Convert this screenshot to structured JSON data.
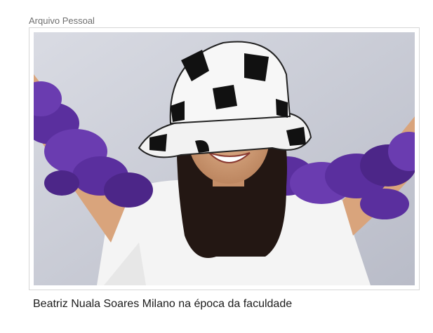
{
  "article_figure": {
    "credit": "Arquivo Pessoal",
    "caption": "Beatriz Nuala Soares Milano na época da faculdade",
    "photo_subject": "smiling-woman-with-soccer-ball-hat-and-purple-feather-boa"
  },
  "colors": {
    "background": "#ffffff",
    "credit_text": "#6f6f6f",
    "caption_text": "#1b1b1b",
    "frame_border": "#d6d6d6",
    "boa_purple": "#5a2f9e",
    "backdrop": "#c9ccd6"
  }
}
